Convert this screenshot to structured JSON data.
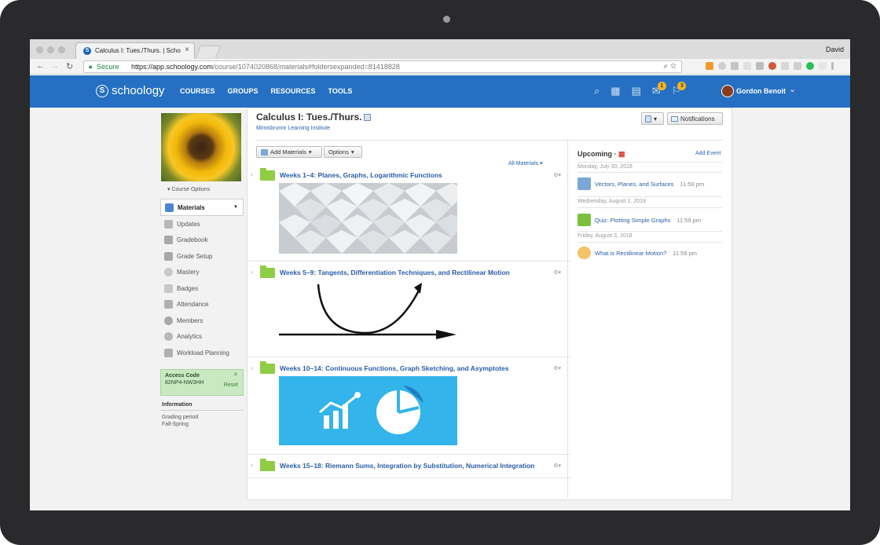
{
  "browser": {
    "tab_title": "Calculus I: Tues./Thurs. | Scho",
    "tab_close": "×",
    "user": "David",
    "secure_label": "Secure",
    "url_host": "https://app.schoology.com",
    "url_path": "/course/1074020868/materials#foldersexpanded=81418828"
  },
  "header": {
    "logo": "schoology",
    "logo_letter": "S",
    "nav": [
      "COURSES",
      "GROUPS",
      "RESOURCES",
      "TOOLS"
    ],
    "message_badge": "1",
    "notification_badge": "3",
    "user_name": "Gordon Benoit"
  },
  "course": {
    "title": "Calculus I: Tues./Thurs.",
    "school": "Mimisbrunnr Learning Institute",
    "course_options": "Course Options",
    "notifications_label": "Notifications"
  },
  "sidebar": {
    "items": [
      {
        "label": "Materials",
        "color": "#4c86d0"
      },
      {
        "label": "Updates",
        "color": "#b8b8b8"
      },
      {
        "label": "Gradebook",
        "color": "#a8a8a8"
      },
      {
        "label": "Grade Setup",
        "color": "#a8a8a8"
      },
      {
        "label": "Mastery",
        "color": "#c8c8c8"
      },
      {
        "label": "Badges",
        "color": "#c8c8c8"
      },
      {
        "label": "Attendance",
        "color": "#b0b0b0"
      },
      {
        "label": "Members",
        "color": "#a8a8a8"
      },
      {
        "label": "Analytics",
        "color": "#b8b8b8"
      },
      {
        "label": "Workload Planning",
        "color": "#b0b0b0"
      }
    ],
    "access_code_label": "Access Code",
    "access_code": "82NP4-NW3HH",
    "reset_label": "Reset",
    "info_title": "Information",
    "grading_label": "Grading period",
    "grading_value": "Fall-Spring"
  },
  "toolbar": {
    "add_materials": "Add Materials",
    "options": "Options",
    "all_materials": "All Materials"
  },
  "folders": [
    {
      "title": "Weeks 1–4: Planes, Graphs, Logarithmic Functions"
    },
    {
      "title": "Weeks 5–9: Tangents, Differentiation Techniques, and Rectilinear Motion"
    },
    {
      "title": "Weeks 10–14: Continuous Functions, Graph Sketching, and Asymptotes"
    },
    {
      "title": "Weeks 15–18: Riemann Sums, Integration by Substitution, Numerical Integration"
    }
  ],
  "upcoming": {
    "title": "Upcoming",
    "add_event": "Add Event",
    "days": [
      {
        "date": "Monday, July 30, 2018",
        "item": "Vectors, Planes, and Surfaces",
        "time": "11:59 pm",
        "icon_color": "#7aa7d8"
      },
      {
        "date": "Wednesday, August 1, 2018",
        "item": "Quiz: Plotting Simple Graphs",
        "time": "11:59 pm",
        "icon_color": "#7cc13e"
      },
      {
        "date": "Friday, August 3, 2018",
        "item": "What is Rectilinear Motion?",
        "time": "11:59 pm",
        "icon_color": "#f3c26b"
      }
    ]
  }
}
